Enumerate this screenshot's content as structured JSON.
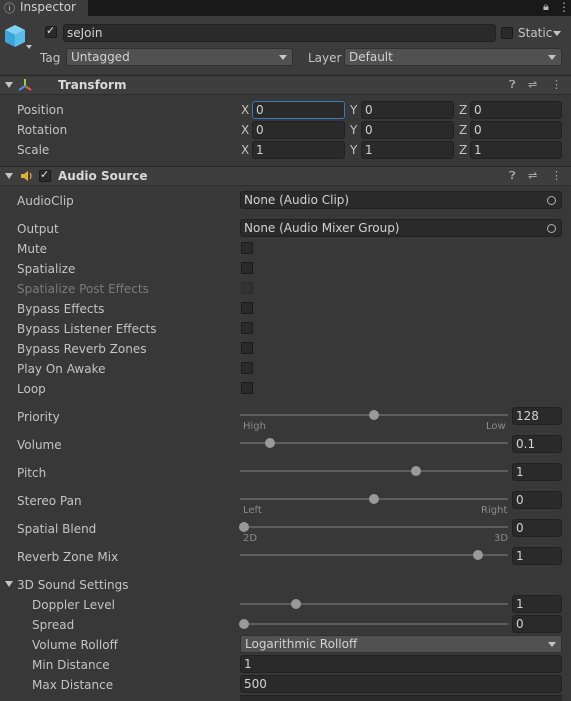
{
  "tab": {
    "title": "Inspector"
  },
  "object": {
    "name": "seJoin",
    "static_label": "Static",
    "tag_label": "Tag",
    "tag_value": "Untagged",
    "layer_label": "Layer",
    "layer_value": "Default"
  },
  "transform": {
    "title": "Transform",
    "rows": [
      {
        "label": "Position",
        "x": "0",
        "y": "0",
        "z": "0"
      },
      {
        "label": "Rotation",
        "x": "0",
        "y": "0",
        "z": "0"
      },
      {
        "label": "Scale",
        "x": "1",
        "y": "1",
        "z": "1"
      }
    ],
    "axes": {
      "x": "X",
      "y": "Y",
      "z": "Z"
    }
  },
  "audio_source": {
    "title": "Audio Source",
    "audio_clip_label": "AudioClip",
    "audio_clip_value": "None (Audio Clip)",
    "output_label": "Output",
    "output_value": "None (Audio Mixer Group)",
    "toggles": [
      {
        "label": "Mute",
        "checked": false,
        "disabled": false
      },
      {
        "label": "Spatialize",
        "checked": false,
        "disabled": false
      },
      {
        "label": "Spatialize Post Effects",
        "checked": false,
        "disabled": true
      },
      {
        "label": "Bypass Effects",
        "checked": false,
        "disabled": false
      },
      {
        "label": "Bypass Listener Effects",
        "checked": false,
        "disabled": false
      },
      {
        "label": "Bypass Reverb Zones",
        "checked": false,
        "disabled": false
      },
      {
        "label": "Play On Awake",
        "checked": false,
        "disabled": false
      },
      {
        "label": "Loop",
        "checked": false,
        "disabled": false
      }
    ],
    "sliders": {
      "priority": {
        "label": "Priority",
        "value": "128",
        "fraction": 0.5,
        "min_label": "High",
        "max_label": "Low"
      },
      "volume": {
        "label": "Volume",
        "value": "0.1",
        "fraction": 0.1
      },
      "pitch": {
        "label": "Pitch",
        "value": "1",
        "fraction": 0.66
      },
      "stereo_pan": {
        "label": "Stereo Pan",
        "value": "0",
        "fraction": 0.5,
        "min_label": "Left",
        "max_label": "Right"
      },
      "spatial_blend": {
        "label": "Spatial Blend",
        "value": "0",
        "fraction": 0.0,
        "min_label": "2D",
        "max_label": "3D"
      },
      "reverb_zone_mix": {
        "label": "Reverb Zone Mix",
        "value": "1",
        "fraction": 0.9
      }
    },
    "sound3d": {
      "title": "3D Sound Settings",
      "doppler": {
        "label": "Doppler Level",
        "value": "1",
        "fraction": 0.2
      },
      "spread": {
        "label": "Spread",
        "value": "0",
        "fraction": 0.0
      },
      "volume_rolloff_label": "Volume Rolloff",
      "volume_rolloff_value": "Logarithmic Rolloff",
      "min_distance_label": "Min Distance",
      "min_distance_value": "1",
      "max_distance_label": "Max Distance",
      "max_distance_value": "500"
    }
  },
  "colors": {
    "background": "#383838",
    "accent": "#3a79bb"
  }
}
